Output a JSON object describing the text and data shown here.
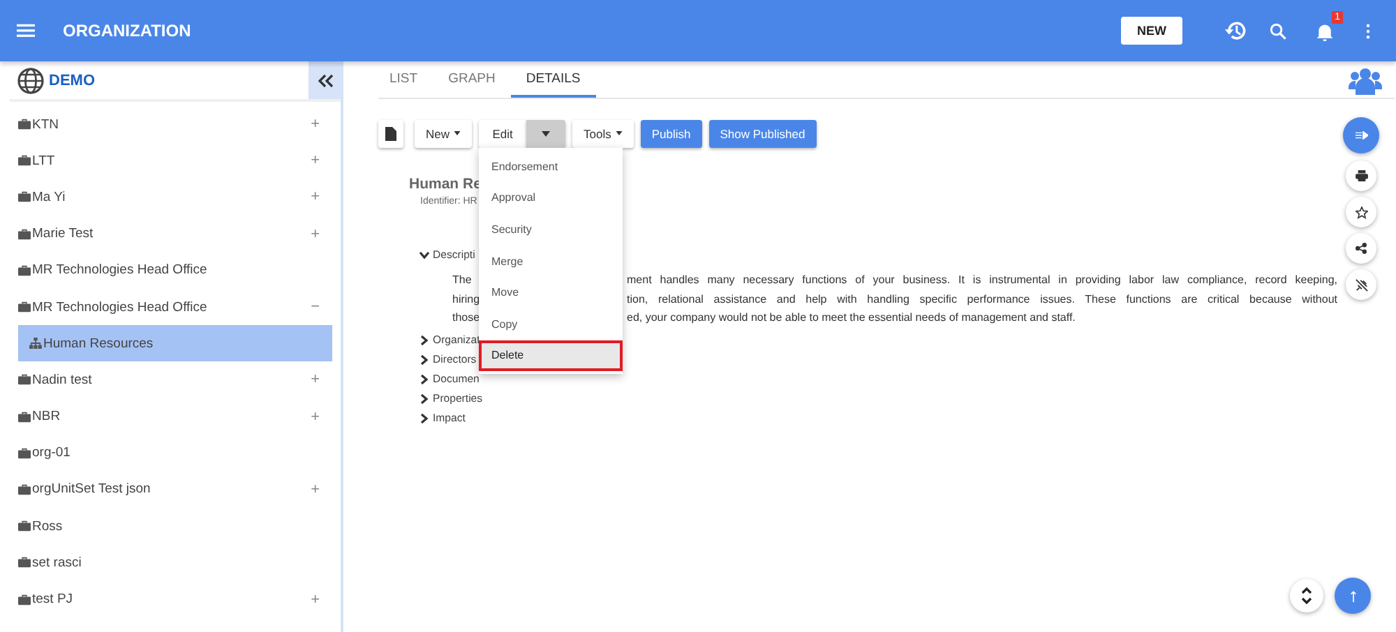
{
  "header": {
    "title": "ORGANIZATION",
    "new_button": "NEW",
    "notification_count": "1"
  },
  "sidebar": {
    "org_name": "DEMO",
    "items": [
      {
        "label": "KTN",
        "toggle": "+",
        "selected": false
      },
      {
        "label": "LTT",
        "toggle": "+",
        "selected": false
      },
      {
        "label": "Ma Yi",
        "toggle": "+",
        "selected": false
      },
      {
        "label": "Marie Test",
        "toggle": "+",
        "selected": false
      },
      {
        "label": "MR Technologies Head Office",
        "selected": false
      },
      {
        "label": "MR Technologies Head Office",
        "toggle": "−",
        "selected": false,
        "children": [
          {
            "label": "Human Resources",
            "selected": true
          }
        ]
      },
      {
        "label": "Nadin test",
        "toggle": "+",
        "selected": false
      },
      {
        "label": "NBR",
        "toggle": "+",
        "selected": false
      },
      {
        "label": "org-01",
        "selected": false
      },
      {
        "label": "orgUnitSet Test json",
        "toggle": "+",
        "selected": false
      },
      {
        "label": "Ross",
        "selected": false
      },
      {
        "label": "set rasci",
        "selected": false
      },
      {
        "label": "test PJ",
        "toggle": "+",
        "selected": false
      }
    ]
  },
  "tabs": [
    {
      "label": "LIST",
      "selected": false
    },
    {
      "label": "GRAPH",
      "selected": false
    },
    {
      "label": "DETAILS",
      "selected": true
    }
  ],
  "toolbar": [
    {
      "kind": "icon"
    },
    {
      "kind": "dropdown",
      "label": "New"
    },
    {
      "kind": "split",
      "label": "Edit"
    },
    {
      "kind": "dropdown",
      "label": "Tools"
    },
    {
      "kind": "primary",
      "label": "Publish"
    },
    {
      "kind": "primary",
      "label": "Show Published"
    }
  ],
  "menu": [
    {
      "label": "Endorsement",
      "selected": false
    },
    {
      "label": "Approval",
      "selected": false
    },
    {
      "label": "Security",
      "selected": false
    },
    {
      "label": "Merge",
      "selected": false
    },
    {
      "label": "Move",
      "selected": false
    },
    {
      "label": "Copy",
      "selected": false
    },
    {
      "label": "Delete",
      "selected": true
    }
  ],
  "details": {
    "title": "Human Re",
    "identifier_label": "Identifier:",
    "identifier_value": "HR",
    "sections": [
      {
        "label": "Descripti",
        "expanded": true,
        "lines": [
          {
            "left": "The",
            "right": "ment handles many necessary functions of your business. It is instrumental in providing labor law compliance, record keeping,"
          },
          {
            "left": "hiring",
            "right": "tion, relational assistance and help with handling specific performance issues. These functions are critical because without"
          },
          {
            "left": "those",
            "right": "ed, your company would not be able to meet the essential needs of management and staff."
          }
        ]
      },
      {
        "label": "Organizat",
        "expanded": false
      },
      {
        "label": "Directors",
        "expanded": false
      },
      {
        "label": "Documen",
        "expanded": false
      },
      {
        "label": "Properties",
        "expanded": false
      },
      {
        "label": "Impact",
        "expanded": false
      }
    ]
  }
}
